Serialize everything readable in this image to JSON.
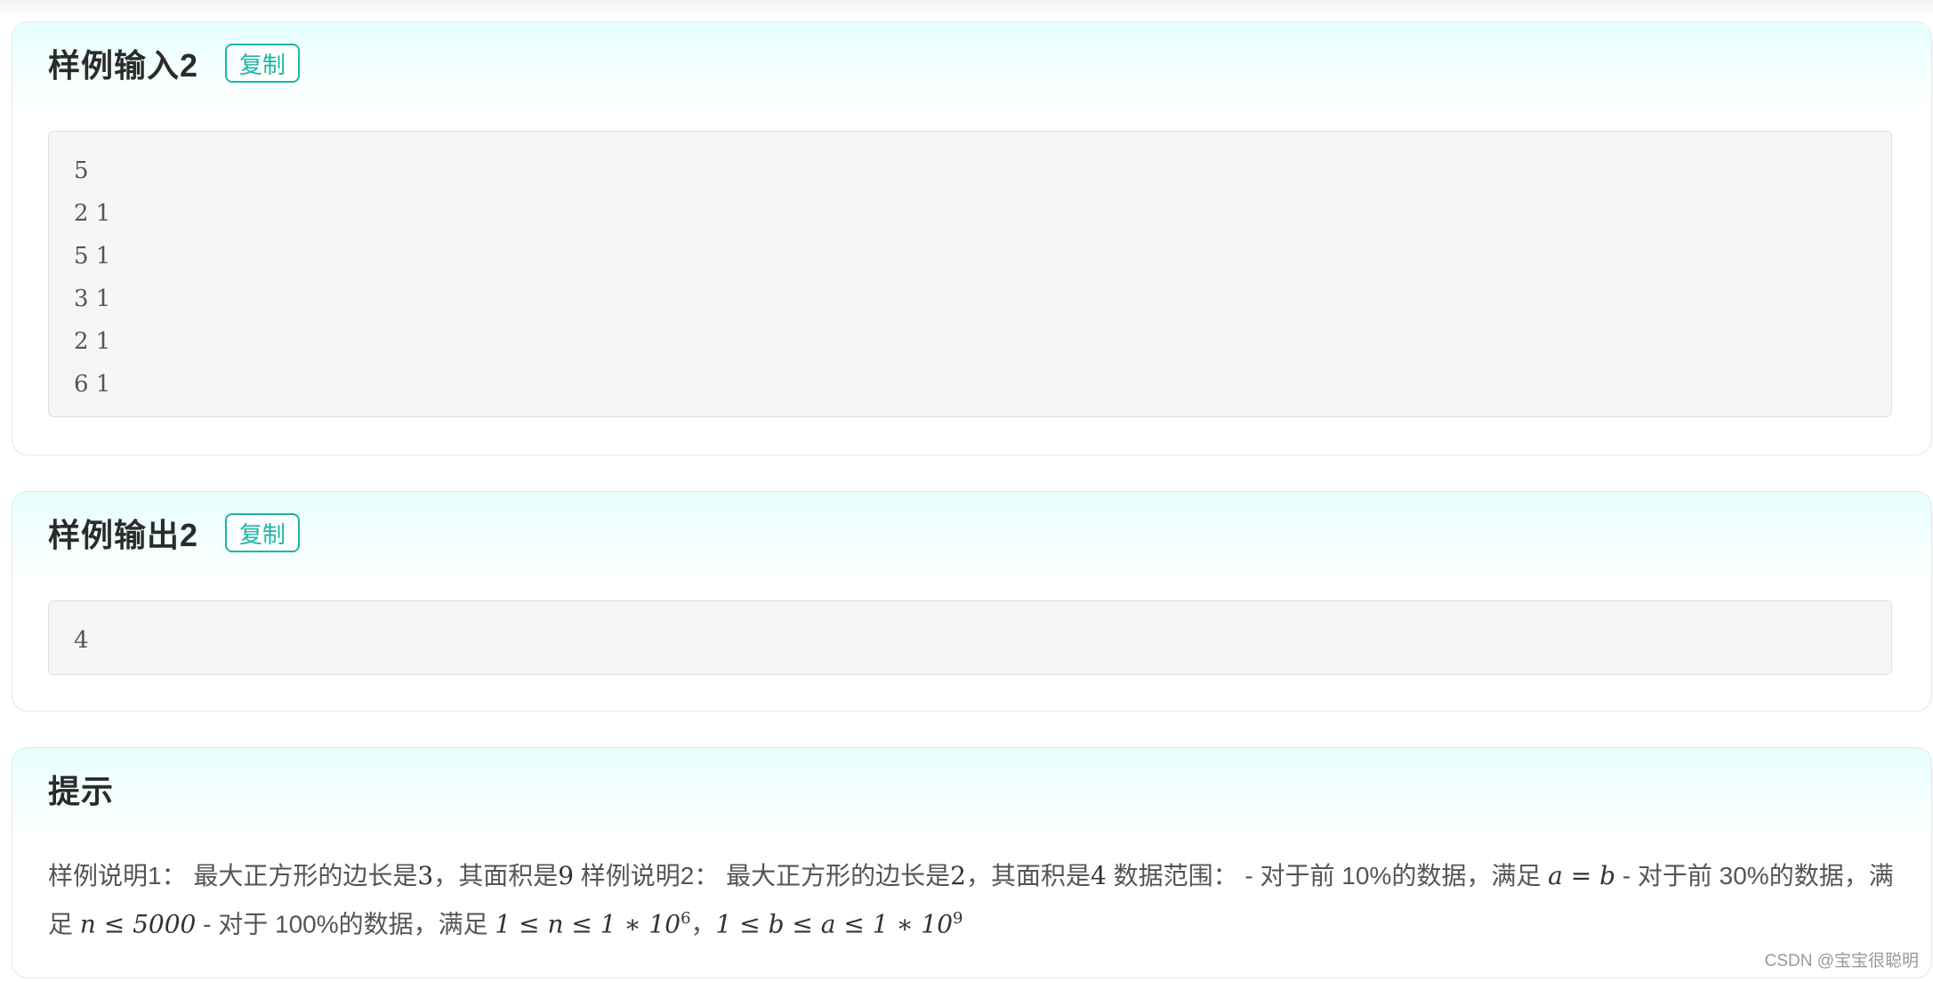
{
  "sample_input": {
    "title": "样例输入2",
    "copy_label": "复制",
    "lines": [
      "5",
      "2 1",
      "5 1",
      "3 1",
      "2 1",
      "6 1"
    ]
  },
  "sample_output": {
    "title": "样例输出2",
    "copy_label": "复制",
    "lines": [
      "4"
    ]
  },
  "hint": {
    "title": "提示",
    "parts": {
      "p1": "样例说明1：  最大正方形的边长是",
      "v1": "3",
      "p2": "，其面积是",
      "v2": "9",
      "p3": " 样例说明2：  最大正方形的边长是",
      "v3": "2",
      "p4": "，其面积是",
      "v4": "4",
      "p5": " 数据范围：  - 对于前 10%的数据，满足 ",
      "m1": "a = b",
      "p6": " - 对于前 30%的数据，满足 ",
      "m2": "n ≤ 5000",
      "p7": " - 对于 100%的数据，满足 ",
      "m3": "1 ≤ n ≤ 1 ∗ 10",
      "m3_sup": "6",
      "p8": "，",
      "m4": "1 ≤ b ≤ a ≤ 1 ∗ 10",
      "m4_sup": "9"
    }
  },
  "watermark": "CSDN @宝宝很聪明"
}
